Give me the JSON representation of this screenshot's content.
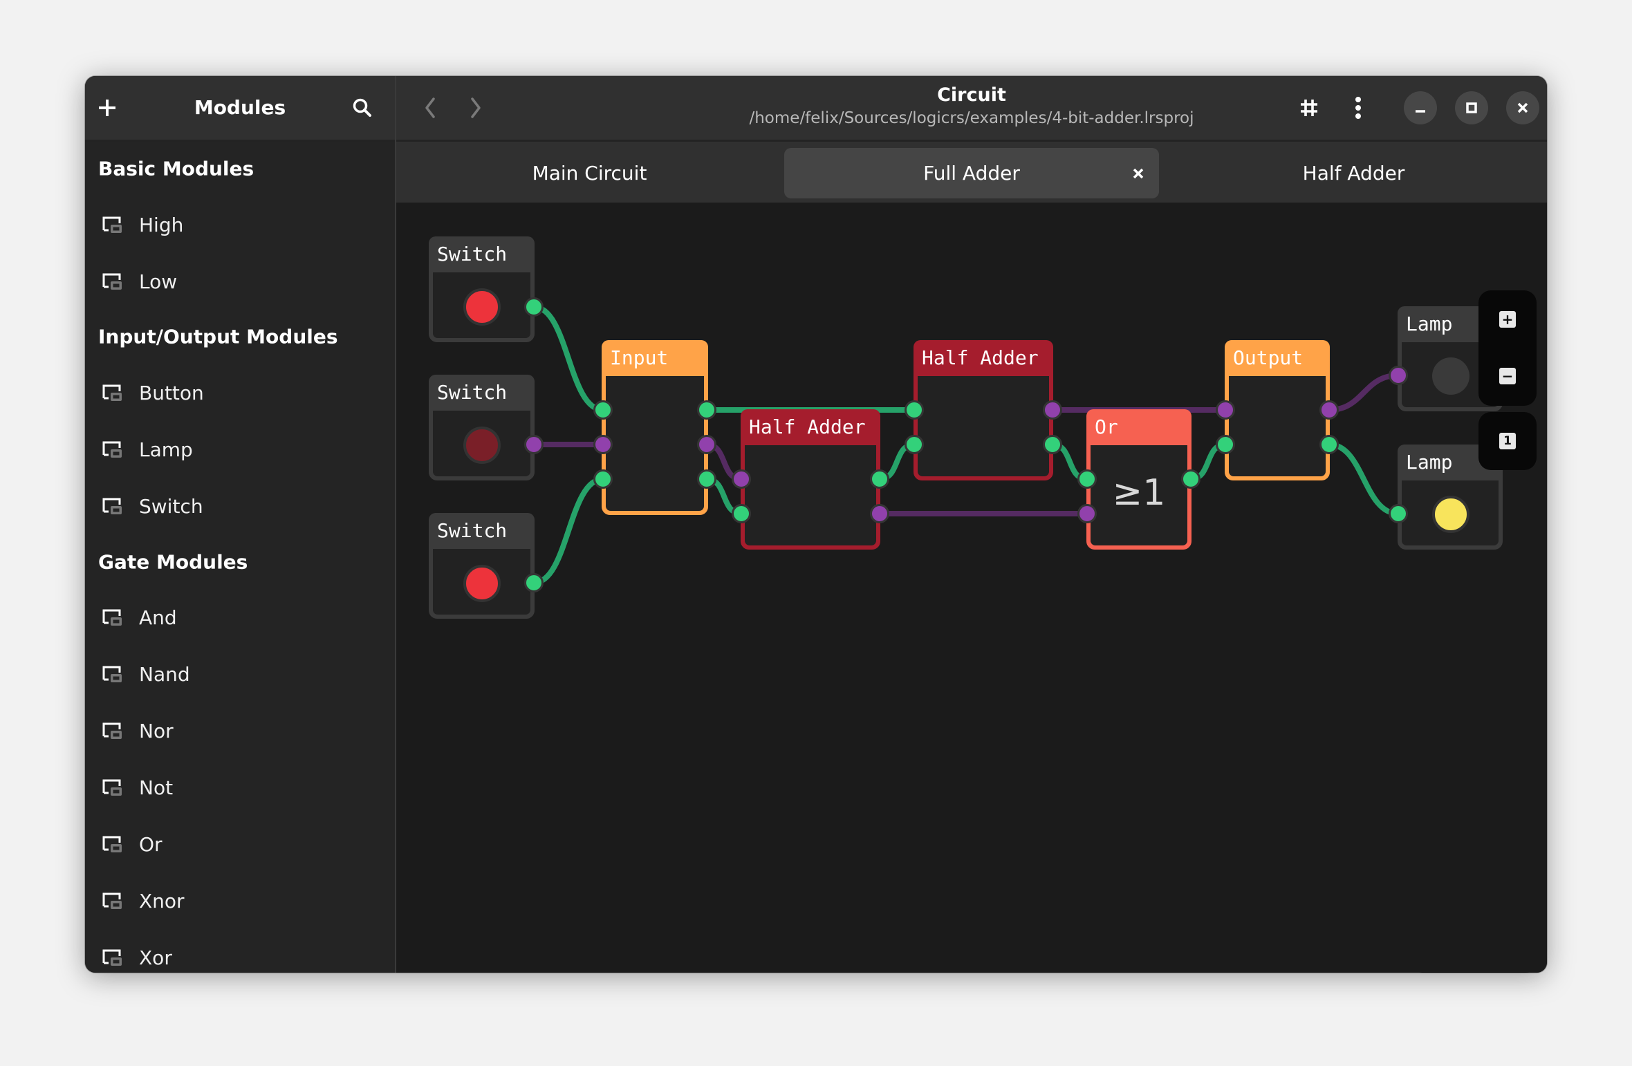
{
  "sidebar": {
    "title": "Modules",
    "add_icon": "plus-icon",
    "search_icon": "search-icon",
    "sections": [
      {
        "title": "Basic Modules",
        "items": [
          "High",
          "Low"
        ]
      },
      {
        "title": "Input/Output Modules",
        "items": [
          "Button",
          "Lamp",
          "Switch"
        ]
      },
      {
        "title": "Gate Modules",
        "items": [
          "And",
          "Nand",
          "Nor",
          "Not",
          "Or",
          "Xnor",
          "Xor"
        ]
      }
    ],
    "item_icon": "module-icon"
  },
  "header": {
    "title": "Circuit",
    "subtitle": "/home/felix/Sources/logicrs/examples/4-bit-adder.lrsproj",
    "icons": [
      "chevron-left-icon",
      "chevron-right-icon",
      "grid-icon",
      "menu-kebab-icon",
      "minimize-icon",
      "maximize-icon",
      "close-icon"
    ]
  },
  "tabs": [
    {
      "label": "Main Circuit",
      "active": false
    },
    {
      "label": "Full Adder",
      "active": true,
      "closable": true
    },
    {
      "label": "Half Adder",
      "active": false
    }
  ],
  "canvas": {
    "zoom_controls": {
      "zoom_in": "+",
      "zoom_out": "−",
      "reset": "1"
    },
    "nodes": [
      {
        "id": "sw1",
        "label": "Switch",
        "kind": "switch",
        "state": "on"
      },
      {
        "id": "sw2",
        "label": "Switch",
        "kind": "switch",
        "state": "off"
      },
      {
        "id": "sw3",
        "label": "Switch",
        "kind": "switch",
        "state": "on"
      },
      {
        "id": "input",
        "label": "Input",
        "kind": "input"
      },
      {
        "id": "ha1",
        "label": "Half Adder",
        "kind": "half-adder"
      },
      {
        "id": "ha2",
        "label": "Half Adder",
        "kind": "half-adder"
      },
      {
        "id": "or",
        "label": "Or",
        "kind": "or",
        "symbol": "≥1"
      },
      {
        "id": "output",
        "label": "Output",
        "kind": "output"
      },
      {
        "id": "lamp1",
        "label": "Lamp",
        "kind": "lamp",
        "state": "off"
      },
      {
        "id": "lamp2",
        "label": "Lamp",
        "kind": "lamp",
        "state": "on"
      }
    ],
    "wires": [
      {
        "from": "sw1.out",
        "to": "input.in0",
        "signal": "high"
      },
      {
        "from": "sw2.out",
        "to": "input.in1",
        "signal": "low"
      },
      {
        "from": "sw3.out",
        "to": "input.in2",
        "signal": "high"
      },
      {
        "from": "input.out0",
        "to": "ha2.in0",
        "signal": "high"
      },
      {
        "from": "input.out1",
        "to": "ha1.in0",
        "signal": "low"
      },
      {
        "from": "input.out2",
        "to": "ha1.in1",
        "signal": "high"
      },
      {
        "from": "ha1.out0",
        "to": "ha2.in1",
        "signal": "high"
      },
      {
        "from": "ha1.out1",
        "to": "or.in1",
        "signal": "low"
      },
      {
        "from": "ha2.out0",
        "to": "output.in0",
        "signal": "low"
      },
      {
        "from": "ha2.out1",
        "to": "or.in0",
        "signal": "high"
      },
      {
        "from": "or.out",
        "to": "output.in1",
        "signal": "high"
      },
      {
        "from": "output.out0",
        "to": "lamp1.in",
        "signal": "low"
      },
      {
        "from": "output.out1",
        "to": "lamp2.in",
        "signal": "high"
      }
    ]
  },
  "colors": {
    "signal_high_port": "#33d17a",
    "signal_high_wire": "#26a269",
    "signal_low_port": "#9141ac",
    "signal_low_wire": "#552b62",
    "switch_on": "#ed333b",
    "switch_off": "#7a1f28",
    "lamp_on": "#f8e45c",
    "lamp_off": "#3a3a3a",
    "io_module": "#ffa348",
    "custom_module": "#a51d2d",
    "gate": "#f66151"
  }
}
